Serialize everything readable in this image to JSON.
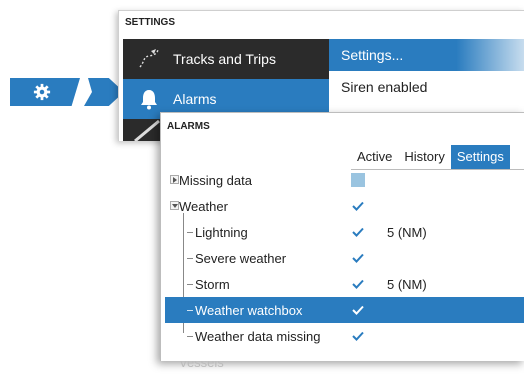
{
  "settings_dialog": {
    "title": "SETTINGS",
    "menu": [
      {
        "label": "Tracks and Trips",
        "icon": "tracks-icon",
        "selected": false
      },
      {
        "label": "Alarms",
        "icon": "bell-icon",
        "selected": true
      }
    ],
    "submenu": [
      {
        "label": "Settings...",
        "selected": true
      },
      {
        "label": "Siren enabled",
        "selected": false
      }
    ]
  },
  "step_icon": "gear-icon",
  "alarms_dialog": {
    "title": "ALARMS",
    "tabs": [
      {
        "label": "Active",
        "selected": false
      },
      {
        "label": "History",
        "selected": false
      },
      {
        "label": "Settings",
        "selected": true
      }
    ],
    "rows": [
      {
        "label": "Missing data",
        "checked": false,
        "value": "",
        "level": 0,
        "expander": "collapsed"
      },
      {
        "label": "Weather",
        "checked": true,
        "value": "",
        "level": 0,
        "expander": "expanded"
      },
      {
        "label": "Lightning",
        "checked": true,
        "value": "5 (NM)",
        "level": 1
      },
      {
        "label": "Severe weather",
        "checked": true,
        "value": "",
        "level": 1
      },
      {
        "label": "Storm",
        "checked": true,
        "value": "5 (NM)",
        "level": 1
      },
      {
        "label": "Weather watchbox",
        "checked": true,
        "value": "",
        "level": 1,
        "selected": true
      },
      {
        "label": "Weather data missing",
        "checked": true,
        "value": "",
        "level": 1
      },
      {
        "label": "Vessels",
        "checked": false,
        "value": "",
        "level": 0,
        "faded": true
      }
    ]
  },
  "colors": {
    "accent": "#2a7cbf",
    "menu_bg": "#2b2b2b"
  }
}
